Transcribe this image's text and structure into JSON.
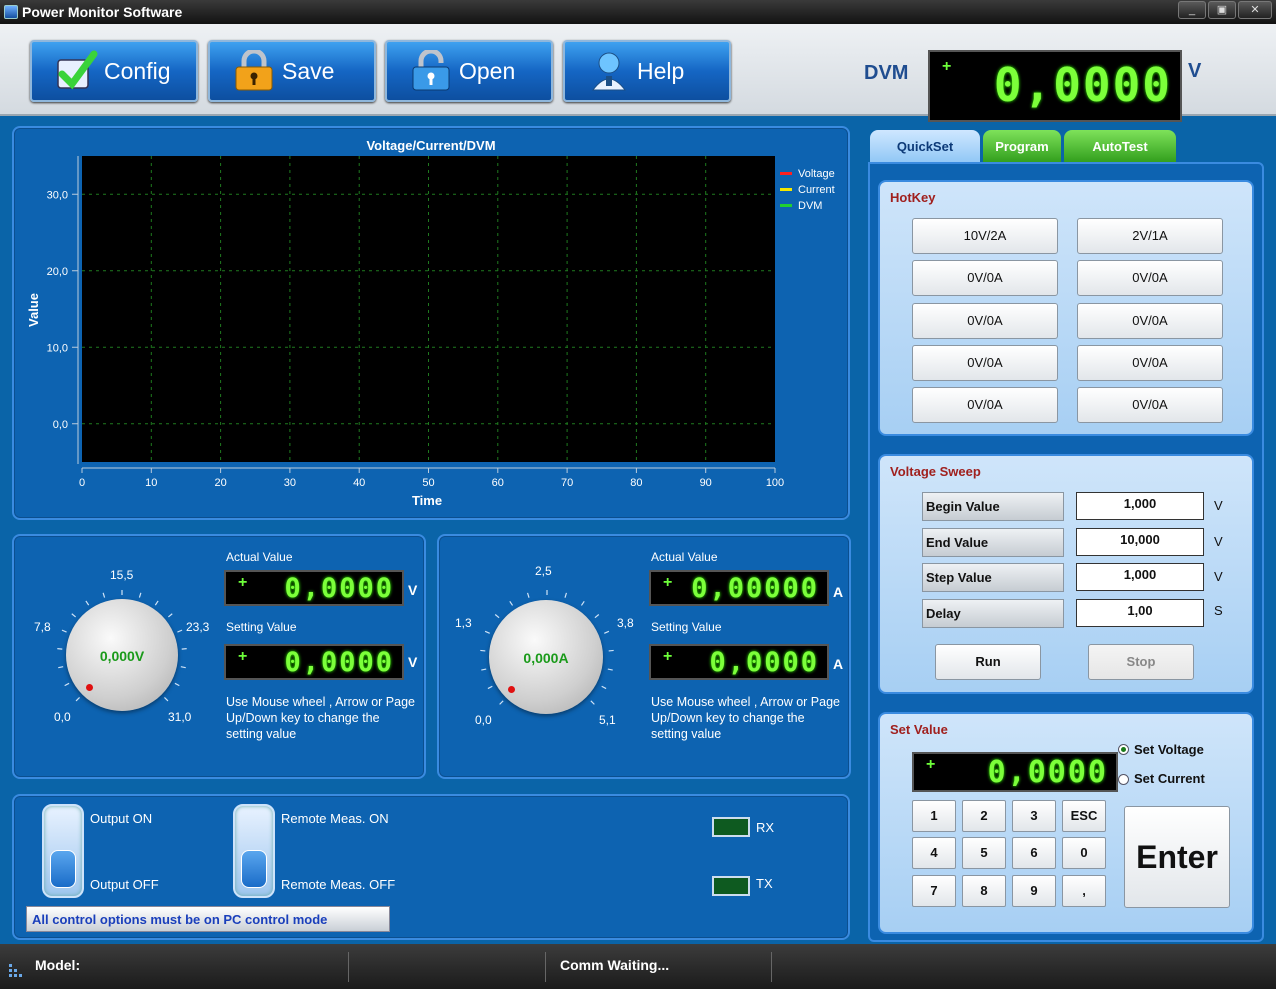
{
  "window": {
    "title": "Power Monitor Software",
    "minimize": "_",
    "restore": "▣",
    "close": "✕"
  },
  "toolbar": {
    "config": "Config",
    "save": "Save",
    "open": "Open",
    "help": "Help"
  },
  "dvm": {
    "label": "DVM",
    "sign": "+",
    "value": "0,0000",
    "unit": "V"
  },
  "chart_data": {
    "type": "line",
    "title": "Voltage/Current/DVM",
    "xlabel": "Time",
    "ylabel": "Value",
    "xlim": [
      0,
      100
    ],
    "ylim": [
      -5,
      35
    ],
    "x_ticks": [
      "0",
      "10",
      "20",
      "30",
      "40",
      "50",
      "60",
      "70",
      "80",
      "90",
      "100"
    ],
    "y_ticks": [
      "0,0",
      "10,0",
      "20,0",
      "30,0"
    ],
    "y_tick_values": [
      0,
      10,
      20,
      30
    ],
    "grid": true,
    "legend_position": "top-right",
    "series": [
      {
        "name": "Voltage",
        "color": "#ff2020",
        "values": []
      },
      {
        "name": "Current",
        "color": "#f5e800",
        "values": []
      },
      {
        "name": "DVM",
        "color": "#20d030",
        "values": []
      }
    ]
  },
  "voltage_panel": {
    "scale": [
      "0,0",
      "7,8",
      "15,5",
      "23,3",
      "31,0"
    ],
    "knob_value": "0,000V",
    "actual_label": "Actual Value",
    "actual_sign": "+",
    "actual_value": "0,0000",
    "setting_label": "Setting Value",
    "setting_sign": "+",
    "setting_value": "0,0000",
    "unit": "V",
    "hint": "Use Mouse wheel , Arrow or Page Up/Down key to change the setting value"
  },
  "current_panel": {
    "scale": [
      "0,0",
      "1,3",
      "2,5",
      "3,8",
      "5,1"
    ],
    "knob_value": "0,000A",
    "actual_label": "Actual Value",
    "actual_sign": "+",
    "actual_value": "0,00000",
    "setting_label": "Setting Value",
    "setting_sign": "+",
    "setting_value": "0,0000",
    "unit": "A",
    "hint": "Use Mouse wheel , Arrow or Page Up/Down key to change the setting value"
  },
  "switches": {
    "output_on": "Output ON",
    "output_off": "Output OFF",
    "remote_on": "Remote Meas. ON",
    "remote_off": "Remote Meas. OFF",
    "rx": "RX",
    "tx": "TX",
    "notice": "All control options must be on PC control mode"
  },
  "tabs": [
    "QuickSet",
    "Program",
    "AutoTest"
  ],
  "hotkey": {
    "title": "HotKey",
    "buttons": [
      "10V/2A",
      "2V/1A",
      "0V/0A",
      "0V/0A",
      "0V/0A",
      "0V/0A",
      "0V/0A",
      "0V/0A",
      "0V/0A",
      "0V/0A"
    ]
  },
  "sweep": {
    "title": "Voltage Sweep",
    "rows": [
      {
        "label": "Begin Value",
        "value": "1,000",
        "unit": "V"
      },
      {
        "label": "End Value",
        "value": "10,000",
        "unit": "V"
      },
      {
        "label": "Step Value",
        "value": "1,000",
        "unit": "V"
      },
      {
        "label": "Delay",
        "value": "1,00",
        "unit": "S"
      }
    ],
    "run": "Run",
    "stop": "Stop"
  },
  "set_value": {
    "title": "Set Value",
    "sign": "+",
    "value": "0,0000",
    "set_voltage": "Set Voltage",
    "set_current": "Set Current",
    "keys": [
      "1",
      "2",
      "3",
      "ESC",
      "4",
      "5",
      "6",
      "0",
      "7",
      "8",
      "9",
      ","
    ],
    "enter": "Enter"
  },
  "status": {
    "model": "Model:",
    "comm": "Comm Waiting..."
  }
}
